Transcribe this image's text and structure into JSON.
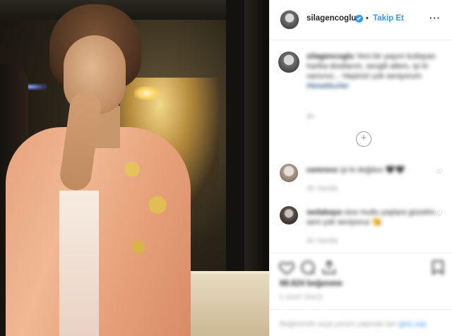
{
  "post": {
    "username": "silagencoglu",
    "verified_badge": "✔",
    "separator": "•",
    "follow_label": "Takip Et",
    "more_icon": "more-horizontal-icon",
    "more_label": "···"
  },
  "caption": {
    "username": "silagencoglu",
    "text": "Yeni bir yaşım kutlayan harika dostlarım, sevgili ailem, iyi ki varsınız... Hepinizi çok seviyorum",
    "link": "#tesekkurler",
    "time": "4h"
  },
  "load_more_label": "+",
  "comments": [
    {
      "username": "cemrexx",
      "text": "iyi ki doğdun 🖤🖤",
      "meta": "4h  Yanıtla"
    },
    {
      "username": "sedakaya",
      "text": "nice mutlu yaşlara güzelim, seni çok seviyoruz 😘",
      "meta": "4h  Yanıtla"
    }
  ],
  "actions": {
    "like_icon": "heart-icon",
    "comment_icon": "comment-icon",
    "share_icon": "share-icon",
    "save_icon": "bookmark-icon"
  },
  "likes": "68.624 beğenme",
  "date": "5 SAAT ÖNCE",
  "login": {
    "text": "Beğenmek veya yorum yapmak için ",
    "link": "giriş yap"
  }
}
